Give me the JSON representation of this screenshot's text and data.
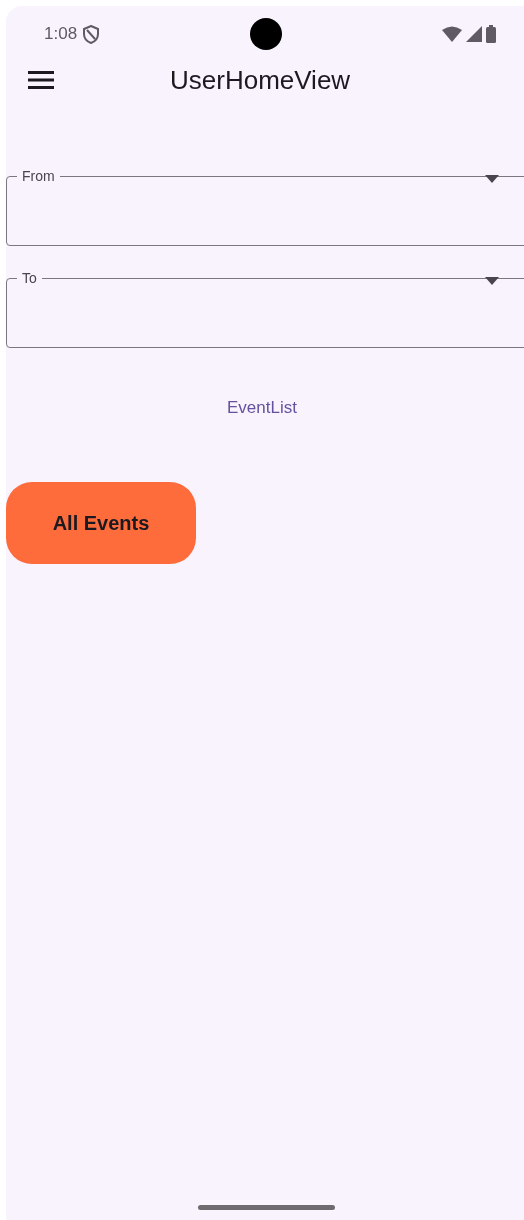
{
  "status_bar": {
    "time": "1:08"
  },
  "app_bar": {
    "title": "UserHomeView"
  },
  "fields": [
    {
      "label": "From"
    },
    {
      "label": "To"
    }
  ],
  "link": "EventList",
  "button": {
    "label": "All Events"
  }
}
